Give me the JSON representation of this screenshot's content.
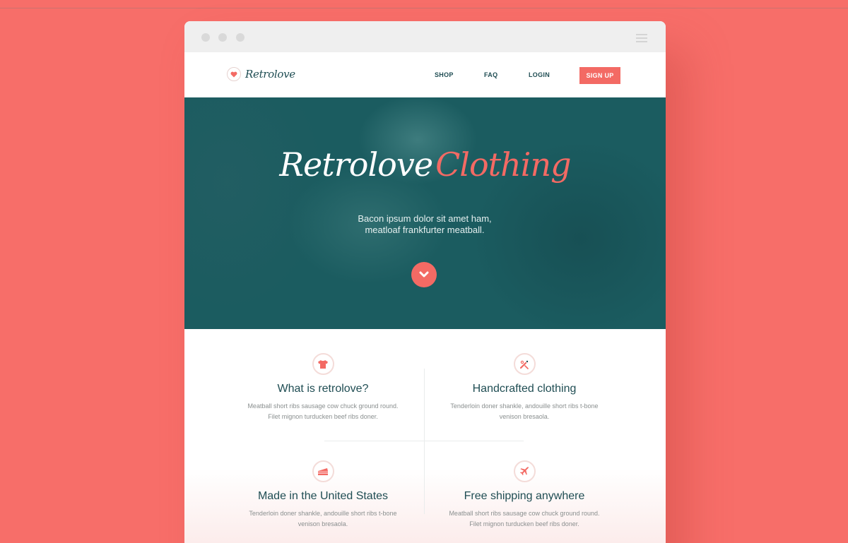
{
  "brand": {
    "name": "Retrolove",
    "accent": "#f36a64",
    "dark": "#1f4d53",
    "background": "#f76e69"
  },
  "nav": {
    "items": [
      {
        "label": "SHOP"
      },
      {
        "label": "FAQ"
      },
      {
        "label": "LOGIN"
      }
    ],
    "cta": "SIGN UP"
  },
  "hero": {
    "title_part1": "Retrolove",
    "title_part2": "Clothing",
    "subtitle_line1": "Bacon ipsum dolor sit amet ham,",
    "subtitle_line2": "meatloaf frankfurter meatball."
  },
  "features": [
    {
      "icon": "tshirt-icon",
      "title": "What is retrolove?",
      "text": "Meatball short ribs sausage cow chuck ground round. Filet mignon turducken beef ribs doner."
    },
    {
      "icon": "sewing-tools-icon",
      "title": "Handcrafted clothing",
      "text": "Tenderloin doner shankle, andouille short ribs t-bone venison bresaola."
    },
    {
      "icon": "cake-slice-icon",
      "title": "Made in the United States",
      "text": "Tenderloin doner shankle, andouille short ribs t-bone venison bresaola."
    },
    {
      "icon": "airplane-icon",
      "title": "Free shipping anywhere",
      "text": "Meatball short ribs sausage cow chuck ground round. Filet mignon turducken beef ribs doner."
    }
  ]
}
